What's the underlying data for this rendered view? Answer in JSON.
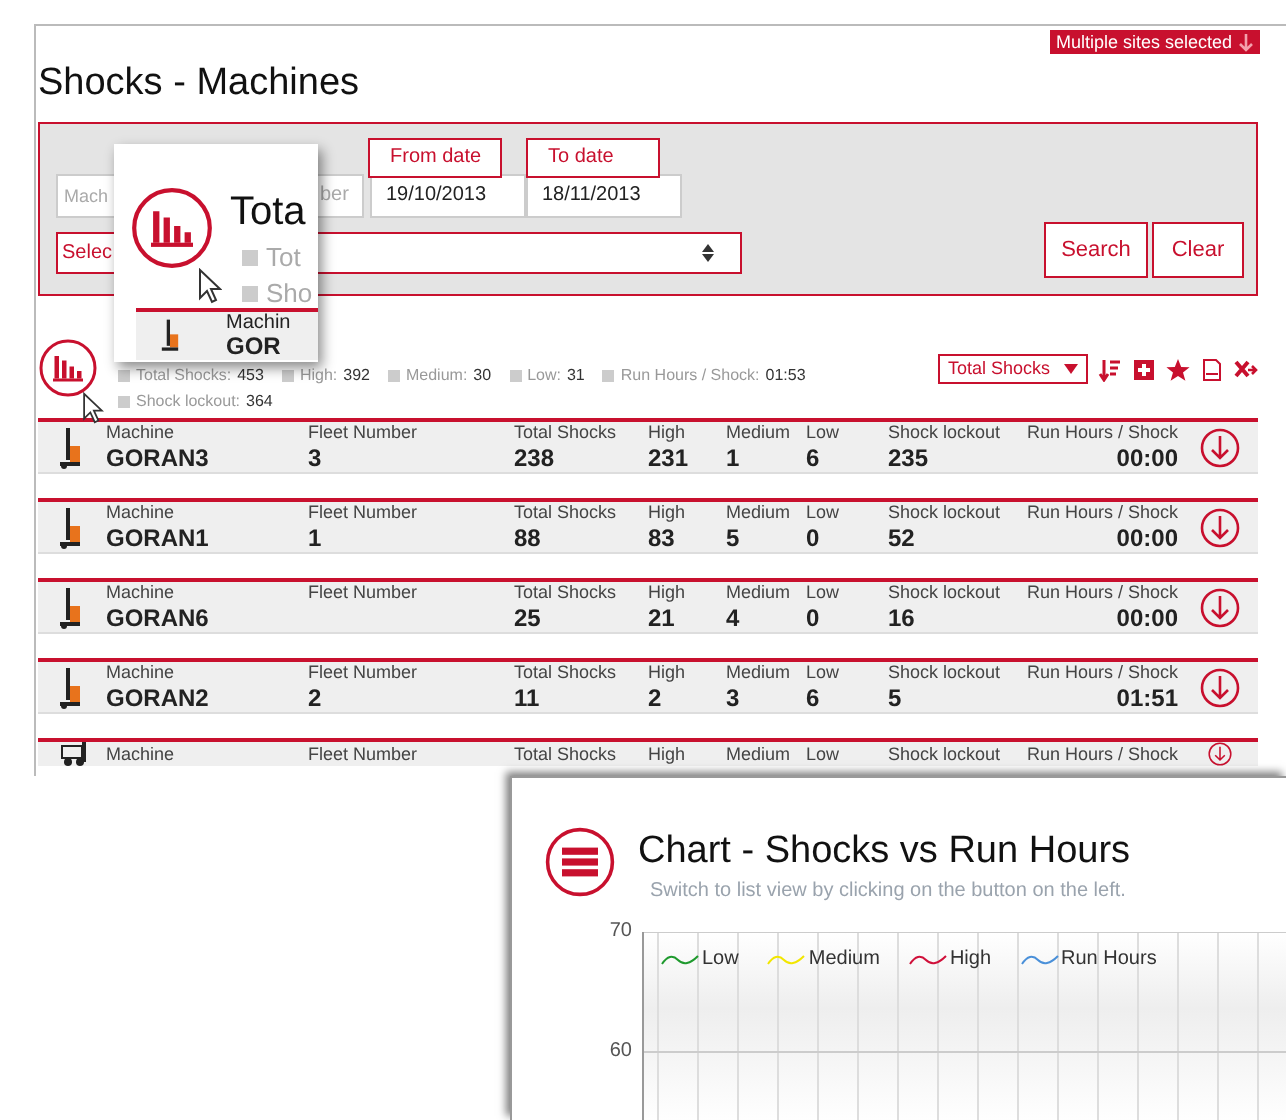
{
  "site_selector": {
    "label": "Multiple sites selected"
  },
  "page_title": "Shocks - Machines",
  "filters": {
    "machine": {
      "placeholder": "Mach"
    },
    "fleet_number": {
      "placeholder": "ber"
    },
    "from_date": {
      "label": "From date",
      "value": "19/10/2013"
    },
    "to_date": {
      "label": "To date",
      "value": "18/11/2013"
    },
    "select": {
      "value": "Selec"
    },
    "buttons": [
      "Search",
      "Clear"
    ]
  },
  "popup": {
    "title": "Tota",
    "legend": [
      "Tot",
      "Sho"
    ],
    "row": {
      "label": "Machin",
      "value": "GOR"
    }
  },
  "summary": [
    {
      "label": "Total Shocks:",
      "value": "453"
    },
    {
      "label": "High:",
      "value": "392"
    },
    {
      "label": "Medium:",
      "value": "30"
    },
    {
      "label": "Low:",
      "value": "31"
    },
    {
      "label": "Run Hours / Shock:",
      "value": "01:53"
    },
    {
      "label": "Shock lockout:",
      "value": "364"
    }
  ],
  "sort": {
    "value": "Total Shocks"
  },
  "rows": [
    {
      "kind": "reach-truck",
      "fields": [
        {
          "label": "Machine",
          "value": "GORAN3"
        },
        {
          "label": "Fleet Number",
          "value": "3"
        },
        {
          "label": "Total Shocks",
          "value": "238"
        },
        {
          "label": "High",
          "value": "231"
        },
        {
          "label": "Medium",
          "value": "1"
        },
        {
          "label": "Low",
          "value": "6"
        },
        {
          "label": "Shock lockout",
          "value": "235"
        },
        {
          "label": "Run Hours / Shock",
          "value": "00:00"
        }
      ]
    },
    {
      "kind": "reach-truck",
      "fields": [
        {
          "label": "Machine",
          "value": "GORAN1"
        },
        {
          "label": "Fleet Number",
          "value": "1"
        },
        {
          "label": "Total Shocks",
          "value": "88"
        },
        {
          "label": "High",
          "value": "83"
        },
        {
          "label": "Medium",
          "value": "5"
        },
        {
          "label": "Low",
          "value": "0"
        },
        {
          "label": "Shock lockout",
          "value": "52"
        },
        {
          "label": "Run Hours / Shock",
          "value": "00:00"
        }
      ]
    },
    {
      "kind": "reach-truck",
      "fields": [
        {
          "label": "Machine",
          "value": "GORAN6"
        },
        {
          "label": "Fleet Number"
        },
        {
          "label": "Total Shocks",
          "value": "25"
        },
        {
          "label": "High",
          "value": "21"
        },
        {
          "label": "Medium",
          "value": "4"
        },
        {
          "label": "Low",
          "value": "0"
        },
        {
          "label": "Shock lockout",
          "value": "16"
        },
        {
          "label": "Run Hours / Shock",
          "value": "00:00"
        }
      ]
    },
    {
      "kind": "reach-truck",
      "fields": [
        {
          "label": "Machine",
          "value": "GORAN2"
        },
        {
          "label": "Fleet Number",
          "value": "2"
        },
        {
          "label": "Total Shocks",
          "value": "11"
        },
        {
          "label": "High",
          "value": "2"
        },
        {
          "label": "Medium",
          "value": "3"
        },
        {
          "label": "Low",
          "value": "6"
        },
        {
          "label": "Shock lockout",
          "value": "5"
        },
        {
          "label": "Run Hours / Shock",
          "value": "01:51"
        }
      ]
    },
    {
      "kind": "forklift",
      "fields": [
        {
          "label": "Machine"
        },
        {
          "label": "Fleet Number"
        },
        {
          "label": "Total Shocks"
        },
        {
          "label": "High"
        },
        {
          "label": "Medium"
        },
        {
          "label": "Low"
        },
        {
          "label": "Shock lockout"
        },
        {
          "label": "Run Hours / Shock"
        }
      ]
    }
  ],
  "chart": {
    "title": "Chart - Shocks vs Run Hours",
    "subtitle": "Switch to list view by clicking on the button on the left.",
    "legend": [
      {
        "label": "Low",
        "color": "#1f9a2e"
      },
      {
        "label": "Medium",
        "color": "#f2e600"
      },
      {
        "label": "High",
        "color": "#d0103a"
      },
      {
        "label": "Run Hours",
        "color": "#4a90d9"
      }
    ],
    "y_tick_labels": [
      "70",
      "60"
    ]
  }
}
